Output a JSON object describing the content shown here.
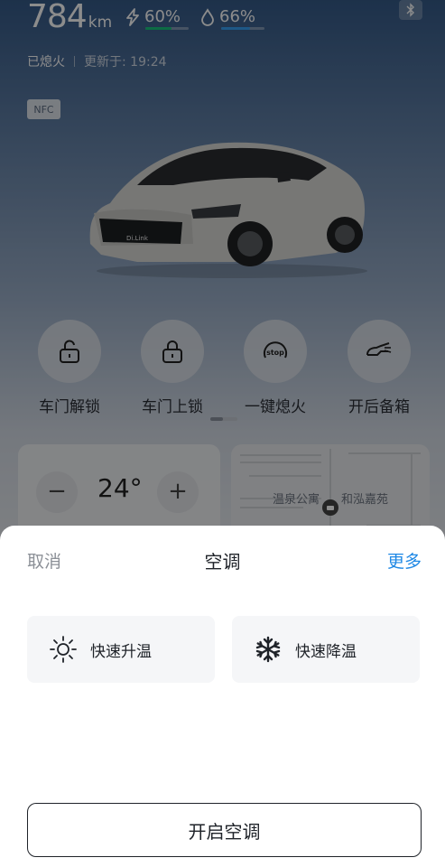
{
  "vehicle": {
    "range_value": "784",
    "range_unit": "km",
    "battery_percent": "60%",
    "battery_level": 0.6,
    "fuel_percent": "66%",
    "fuel_level": 0.66,
    "engine_status": "已熄火",
    "updated_label": "更新于: 19:24",
    "nfc_label": "NFC",
    "car_badge": "Di.Link"
  },
  "controls": [
    {
      "label": "车门解锁",
      "icon": "unlock-icon"
    },
    {
      "label": "车门上锁",
      "icon": "lock-icon"
    },
    {
      "label": "一键熄火",
      "icon": "stop-icon"
    },
    {
      "label": "开后备箱",
      "icon": "trunk-icon"
    }
  ],
  "stop_icon_text": "stop",
  "ac_card": {
    "minus": "−",
    "temperature": "24°",
    "plus": "+"
  },
  "map_card": {
    "poi1": "温泉公寓",
    "poi2": "和泓嘉苑"
  },
  "sheet": {
    "cancel": "取消",
    "title": "空调",
    "more": "更多",
    "options": [
      {
        "label": "快速升温",
        "icon": "sun-icon"
      },
      {
        "label": "快速降温",
        "icon": "snowflake-icon"
      }
    ],
    "primary_button": "开启空调"
  },
  "colors": {
    "accent_blue": "#1e88e5",
    "battery_green": "#19c37d",
    "fuel_blue": "#38a1f4"
  }
}
